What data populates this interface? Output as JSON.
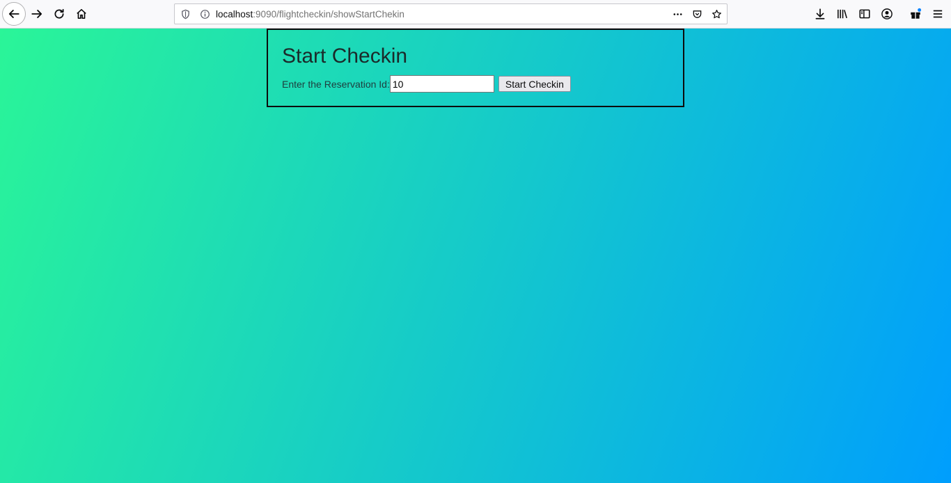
{
  "browser": {
    "url_host": "localhost",
    "url_rest": ":9090/flightcheckin/showStartChekin"
  },
  "page": {
    "heading": "Start Checkin",
    "reservation_label": "Enter the Reservation Id:",
    "reservation_value": "10",
    "submit_label": "Start Checkin"
  },
  "colors": {
    "gradient_start": "#2af598",
    "gradient_end": "#009efd"
  }
}
